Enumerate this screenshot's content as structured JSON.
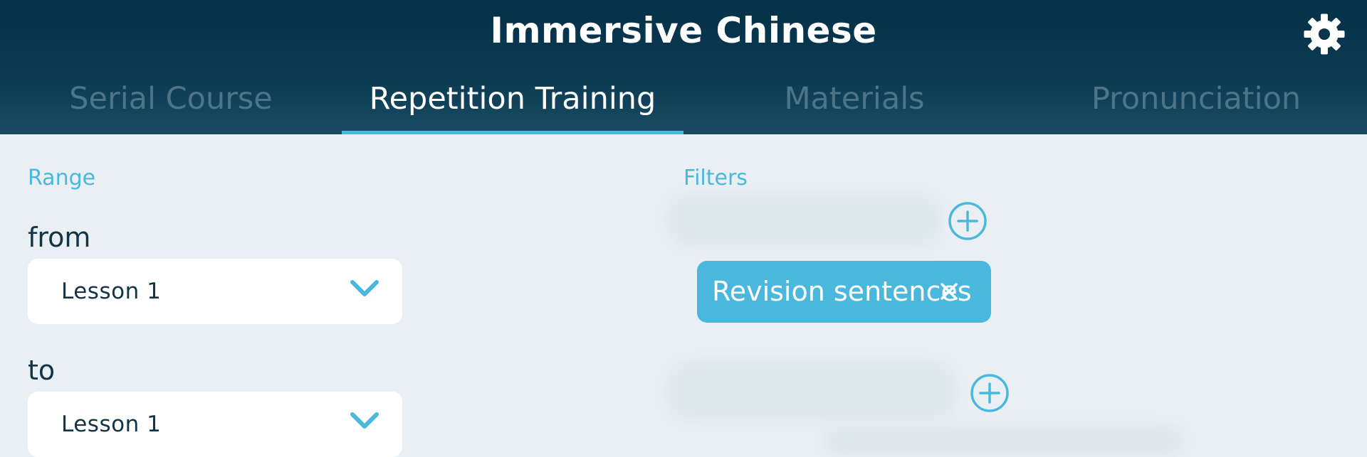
{
  "app": {
    "title": "Immersive Chinese"
  },
  "header": {
    "settings_icon": "gear-icon"
  },
  "tabs": [
    {
      "label": "Serial Course",
      "active": false
    },
    {
      "label": "Repetition Training",
      "active": true
    },
    {
      "label": "Materials",
      "active": false
    },
    {
      "label": "Pronunciation",
      "active": false
    }
  ],
  "range": {
    "heading": "Range",
    "from_label": "from",
    "from_value": "Lesson 1",
    "to_label": "to",
    "to_value": "Lesson 1"
  },
  "filters": {
    "heading": "Filters",
    "chips": [
      {
        "label": "Revision sentences"
      }
    ]
  },
  "colors": {
    "header_dark": "#053048",
    "accent": "#4ab8dd",
    "background": "#e9eff3",
    "tab_inactive": "#4e7488",
    "text_dark": "#123447"
  }
}
